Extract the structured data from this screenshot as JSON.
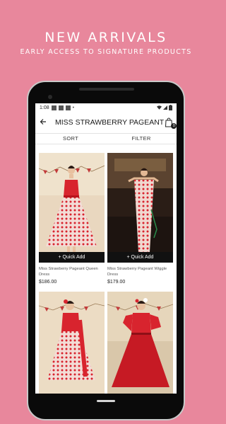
{
  "promo": {
    "title": "NEW ARRIVALS",
    "subtitle": "EARLY ACCESS TO SIGNATURE PRODUCTS"
  },
  "status": {
    "time": "1:08",
    "dot": "•"
  },
  "appbar": {
    "title": "MISS STRAWBERRY PAGEANT",
    "back_icon": "arrow-back-icon",
    "cart_icon": "shopping-bag-icon",
    "cart_count": "0"
  },
  "toolbar": {
    "sort_label": "SORT",
    "filter_label": "FILTER"
  },
  "products": [
    {
      "name": "Miss Strawberry Pageant Queen Dress",
      "price": "$186.00",
      "quick_add": "+ Quick Add"
    },
    {
      "name": "Miss Strawberry Pageant Wiggle Dress",
      "price": "$179.00",
      "quick_add": "+ Quick Add"
    },
    {
      "name": "",
      "price": "",
      "quick_add": ""
    },
    {
      "name": "",
      "price": "",
      "quick_add": ""
    }
  ],
  "colors": {
    "background": "#e8879c",
    "accent": "#111111",
    "dress_red": "#d8242e"
  }
}
